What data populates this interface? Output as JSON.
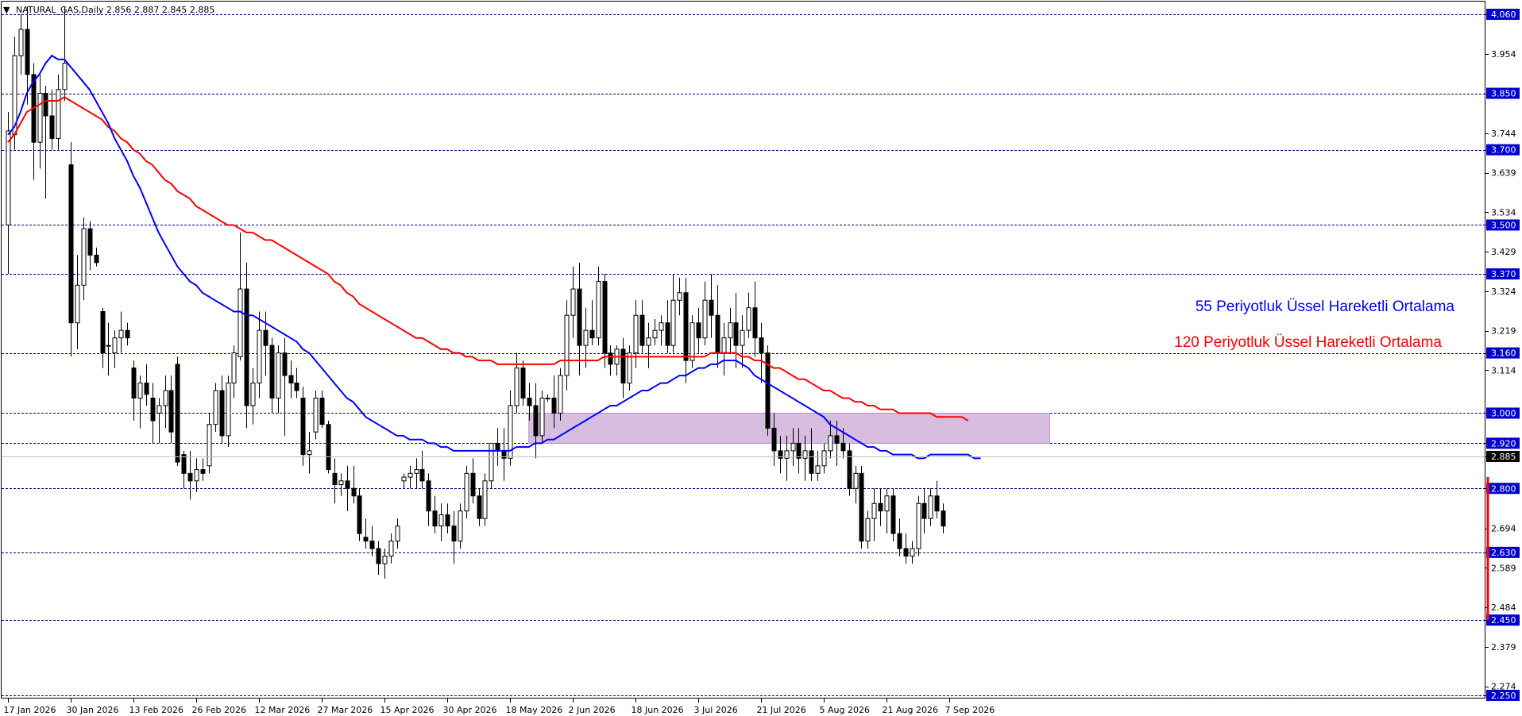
{
  "header": {
    "marker": "▼",
    "text": "NATURAL_GAS,Daily  2.856 2.887 2.845 2.885"
  },
  "legend": {
    "ema55": "55 Periyotluk Üssel Hareketli Ortalama",
    "ema120": "120 Periyotluk Üssel Hareketli Ortalama"
  },
  "colors": {
    "ema55": "#0000ff",
    "ema120": "#ff0000",
    "level_line": "#000080",
    "level_label_bg": "#0000cc",
    "zone": "#d7bde0",
    "bull_body": "#ffffff",
    "bear_body": "#000000",
    "current_price_bg": "#000000",
    "range_bar": "#ff0000"
  },
  "chart_data": {
    "type": "candlestick",
    "symbol": "NATURAL_GAS",
    "timeframe": "Daily",
    "last_ohlc": {
      "open": 2.856,
      "high": 2.887,
      "low": 2.845,
      "close": 2.885
    },
    "ylim": [
      2.25,
      4.07
    ],
    "y_ticks": [
      "4.060",
      "3.954",
      "3.850",
      "3.744",
      "3.700",
      "3.639",
      "3.534",
      "3.500",
      "3.429",
      "3.370",
      "3.324",
      "3.219",
      "3.160",
      "3.114",
      "3.000",
      "2.920",
      "2.885",
      "2.800",
      "2.694",
      "2.630",
      "2.589",
      "2.484",
      "2.450",
      "2.379",
      "2.274",
      "2.250"
    ],
    "x_ticks": [
      "17 Jan 2026",
      "30 Jan 2026",
      "13 Feb 2026",
      "26 Feb 2026",
      "12 Mar 2026",
      "27 Mar 2026",
      "15 Apr 2026",
      "30 Apr 2026",
      "18 May 2026",
      "2 Jun 2026",
      "18 Jun 2026",
      "3 Jul 2026",
      "21 Jul 2026",
      "5 Aug 2026",
      "21 Aug 2026",
      "7 Sep 2026"
    ],
    "x_tick_index": [
      0,
      10,
      20,
      30,
      40,
      50,
      60,
      70,
      80,
      90,
      100,
      110,
      120,
      130,
      140,
      150
    ],
    "levels": [
      4.06,
      3.85,
      3.7,
      3.5,
      3.37,
      3.16,
      3.0,
      2.92,
      2.8,
      2.63,
      2.45,
      2.25
    ],
    "current_price": 2.885,
    "zone": {
      "from_index": 83,
      "to_index": 166,
      "low": 2.92,
      "high": 3.0
    },
    "range_bar": {
      "low": 2.45,
      "high": 2.83
    },
    "candles": [
      [
        3.5,
        3.8,
        3.37,
        3.75
      ],
      [
        3.74,
        4.0,
        3.7,
        3.95
      ],
      [
        3.95,
        4.06,
        3.9,
        4.02
      ],
      [
        4.02,
        4.08,
        3.82,
        3.9
      ],
      [
        3.9,
        3.93,
        3.62,
        3.72
      ],
      [
        3.72,
        3.9,
        3.65,
        3.85
      ],
      [
        3.85,
        3.87,
        3.57,
        3.79
      ],
      [
        3.79,
        3.86,
        3.7,
        3.73
      ],
      [
        3.73,
        3.9,
        3.7,
        3.86
      ],
      [
        3.86,
        4.08,
        3.83,
        3.93
      ],
      [
        3.66,
        3.72,
        3.15,
        3.24
      ],
      [
        3.24,
        3.42,
        3.17,
        3.34
      ],
      [
        3.34,
        3.52,
        3.3,
        3.49
      ],
      [
        3.49,
        3.51,
        3.38,
        3.42
      ],
      [
        3.42,
        3.44,
        3.39,
        3.4
      ],
      [
        3.27,
        3.28,
        3.12,
        3.16
      ],
      [
        3.18,
        3.24,
        3.1,
        3.18
      ],
      [
        3.16,
        3.22,
        3.12,
        3.2
      ],
      [
        3.2,
        3.27,
        3.16,
        3.22
      ],
      [
        3.22,
        3.24,
        3.18,
        3.2
      ],
      [
        3.12,
        3.14,
        2.98,
        3.04
      ],
      [
        3.04,
        3.1,
        2.96,
        3.08
      ],
      [
        3.08,
        3.13,
        3.02,
        3.05
      ],
      [
        3.04,
        3.08,
        2.92,
        2.98
      ],
      [
        3.0,
        3.04,
        2.92,
        3.02
      ],
      [
        3.02,
        3.1,
        2.96,
        3.06
      ],
      [
        3.06,
        3.1,
        2.92,
        2.95
      ],
      [
        3.13,
        3.15,
        2.86,
        2.87
      ],
      [
        2.89,
        2.9,
        2.8,
        2.84
      ],
      [
        2.84,
        2.9,
        2.77,
        2.82
      ],
      [
        2.82,
        2.88,
        2.79,
        2.85
      ],
      [
        2.85,
        2.88,
        2.82,
        2.84
      ],
      [
        2.86,
        3.0,
        2.84,
        2.97
      ],
      [
        2.97,
        3.08,
        2.95,
        3.06
      ],
      [
        3.06,
        3.1,
        2.92,
        2.94
      ],
      [
        2.94,
        3.1,
        2.91,
        3.08
      ],
      [
        3.08,
        3.18,
        3.04,
        3.16
      ],
      [
        3.15,
        3.48,
        3.14,
        3.33
      ],
      [
        3.33,
        3.4,
        2.96,
        3.02
      ],
      [
        3.02,
        3.12,
        2.97,
        3.08
      ],
      [
        3.08,
        3.27,
        3.04,
        3.22
      ],
      [
        3.22,
        3.27,
        3.1,
        3.18
      ],
      [
        3.18,
        3.2,
        3.0,
        3.04
      ],
      [
        3.04,
        3.18,
        3.0,
        3.16
      ],
      [
        3.16,
        3.2,
        2.94,
        3.1
      ],
      [
        3.1,
        3.14,
        3.04,
        3.08
      ],
      [
        3.08,
        3.12,
        3.04,
        3.06
      ],
      [
        3.04,
        3.07,
        2.86,
        2.89
      ],
      [
        2.89,
        2.95,
        2.84,
        2.9
      ],
      [
        2.95,
        3.06,
        2.93,
        3.04
      ],
      [
        3.04,
        3.06,
        2.96,
        2.97
      ],
      [
        2.97,
        2.98,
        2.84,
        2.85
      ],
      [
        2.84,
        2.88,
        2.76,
        2.81
      ],
      [
        2.81,
        2.84,
        2.78,
        2.82
      ],
      [
        2.82,
        2.86,
        2.74,
        2.8
      ],
      [
        2.8,
        2.86,
        2.76,
        2.78
      ],
      [
        2.78,
        2.8,
        2.66,
        2.68
      ],
      [
        2.67,
        2.72,
        2.64,
        2.66
      ],
      [
        2.66,
        2.7,
        2.62,
        2.64
      ],
      [
        2.64,
        2.66,
        2.57,
        2.6
      ],
      [
        2.6,
        2.64,
        2.56,
        2.62
      ],
      [
        2.62,
        2.68,
        2.6,
        2.66
      ],
      [
        2.66,
        2.72,
        2.64,
        2.7
      ],
      [
        2.82,
        2.84,
        2.8,
        2.83
      ],
      [
        2.83,
        2.86,
        2.8,
        2.84
      ],
      [
        2.84,
        2.88,
        2.8,
        2.85
      ],
      [
        2.85,
        2.9,
        2.8,
        2.82
      ],
      [
        2.82,
        2.84,
        2.7,
        2.74
      ],
      [
        2.74,
        2.78,
        2.68,
        2.7
      ],
      [
        2.7,
        2.76,
        2.66,
        2.73
      ],
      [
        2.73,
        2.76,
        2.68,
        2.7
      ],
      [
        2.7,
        2.74,
        2.6,
        2.66
      ],
      [
        2.66,
        2.76,
        2.64,
        2.74
      ],
      [
        2.74,
        2.86,
        2.72,
        2.84
      ],
      [
        2.84,
        2.88,
        2.76,
        2.78
      ],
      [
        2.78,
        2.8,
        2.7,
        2.72
      ],
      [
        2.72,
        2.84,
        2.7,
        2.82
      ],
      [
        2.82,
        2.92,
        2.8,
        2.92
      ],
      [
        2.92,
        2.96,
        2.86,
        2.9
      ],
      [
        2.9,
        2.96,
        2.82,
        2.88
      ],
      [
        2.88,
        3.06,
        2.86,
        3.02
      ],
      [
        3.02,
        3.16,
        3.0,
        3.12
      ],
      [
        3.12,
        3.14,
        3.02,
        3.04
      ],
      [
        3.04,
        3.08,
        2.98,
        3.02
      ],
      [
        3.02,
        3.08,
        2.88,
        2.94
      ],
      [
        2.94,
        3.06,
        2.92,
        3.04
      ],
      [
        3.04,
        3.05,
        3.03,
        3.04
      ],
      [
        3.04,
        3.1,
        2.96,
        3.0
      ],
      [
        3.0,
        3.12,
        2.98,
        3.1
      ],
      [
        3.1,
        3.3,
        3.06,
        3.26
      ],
      [
        3.26,
        3.39,
        3.2,
        3.33
      ],
      [
        3.33,
        3.4,
        3.1,
        3.18
      ],
      [
        3.18,
        3.28,
        3.12,
        3.22
      ],
      [
        3.22,
        3.3,
        3.18,
        3.2
      ],
      [
        3.2,
        3.39,
        3.18,
        3.35
      ],
      [
        3.35,
        3.37,
        3.12,
        3.16
      ],
      [
        3.16,
        3.18,
        3.1,
        3.13
      ],
      [
        3.13,
        3.18,
        3.1,
        3.17
      ],
      [
        3.17,
        3.2,
        3.04,
        3.08
      ],
      [
        3.08,
        3.18,
        3.06,
        3.16
      ],
      [
        3.16,
        3.3,
        3.12,
        3.26
      ],
      [
        3.26,
        3.3,
        3.16,
        3.18
      ],
      [
        3.18,
        3.24,
        3.12,
        3.2
      ],
      [
        3.2,
        3.25,
        3.18,
        3.22
      ],
      [
        3.22,
        3.26,
        3.18,
        3.24
      ],
      [
        3.24,
        3.3,
        3.16,
        3.18
      ],
      [
        3.18,
        3.37,
        3.16,
        3.3
      ],
      [
        3.3,
        3.36,
        3.26,
        3.32
      ],
      [
        3.32,
        3.36,
        3.08,
        3.14
      ],
      [
        3.14,
        3.26,
        3.12,
        3.24
      ],
      [
        3.24,
        3.28,
        3.16,
        3.2
      ],
      [
        3.2,
        3.35,
        3.18,
        3.3
      ],
      [
        3.3,
        3.37,
        3.2,
        3.26
      ],
      [
        3.26,
        3.34,
        3.12,
        3.16
      ],
      [
        3.16,
        3.24,
        3.1,
        3.2
      ],
      [
        3.2,
        3.28,
        3.16,
        3.24
      ],
      [
        3.24,
        3.32,
        3.12,
        3.18
      ],
      [
        3.18,
        3.26,
        3.12,
        3.22
      ],
      [
        3.22,
        3.32,
        3.2,
        3.28
      ],
      [
        3.28,
        3.35,
        3.15,
        3.2
      ],
      [
        3.2,
        3.24,
        3.08,
        3.16
      ],
      [
        3.16,
        3.18,
        2.94,
        2.96
      ],
      [
        2.96,
        3.0,
        2.86,
        2.9
      ],
      [
        2.9,
        2.94,
        2.84,
        2.88
      ],
      [
        2.88,
        2.94,
        2.82,
        2.9
      ],
      [
        2.9,
        2.96,
        2.86,
        2.92
      ],
      [
        2.92,
        2.96,
        2.84,
        2.88
      ],
      [
        2.88,
        2.94,
        2.82,
        2.9
      ],
      [
        2.9,
        2.96,
        2.82,
        2.84
      ],
      [
        2.84,
        2.9,
        2.82,
        2.86
      ],
      [
        2.86,
        2.92,
        2.84,
        2.9
      ],
      [
        2.9,
        2.98,
        2.88,
        2.94
      ],
      [
        2.94,
        2.98,
        2.86,
        2.92
      ],
      [
        2.92,
        2.96,
        2.88,
        2.9
      ],
      [
        2.9,
        2.92,
        2.78,
        2.8
      ],
      [
        2.8,
        2.86,
        2.76,
        2.84
      ],
      [
        2.84,
        2.86,
        2.64,
        2.66
      ],
      [
        2.66,
        2.74,
        2.64,
        2.72
      ],
      [
        2.72,
        2.8,
        2.66,
        2.76
      ],
      [
        2.76,
        2.8,
        2.7,
        2.74
      ],
      [
        2.74,
        2.8,
        2.68,
        2.78
      ],
      [
        2.78,
        2.8,
        2.66,
        2.68
      ],
      [
        2.68,
        2.72,
        2.62,
        2.64
      ],
      [
        2.64,
        2.68,
        2.6,
        2.62
      ],
      [
        2.62,
        2.66,
        2.6,
        2.64
      ],
      [
        2.64,
        2.78,
        2.62,
        2.76
      ],
      [
        2.76,
        2.8,
        2.68,
        2.72
      ],
      [
        2.72,
        2.8,
        2.7,
        2.78
      ],
      [
        2.78,
        2.82,
        2.72,
        2.74
      ],
      [
        2.74,
        2.76,
        2.68,
        2.7
      ]
    ],
    "ema55": [
      3.74,
      3.76,
      3.8,
      3.85,
      3.88,
      3.9,
      3.93,
      3.95,
      3.94,
      3.94,
      3.92,
      3.9,
      3.88,
      3.86,
      3.83,
      3.8,
      3.77,
      3.73,
      3.7,
      3.67,
      3.63,
      3.6,
      3.56,
      3.52,
      3.48,
      3.45,
      3.42,
      3.39,
      3.37,
      3.35,
      3.34,
      3.32,
      3.31,
      3.3,
      3.29,
      3.28,
      3.27,
      3.27,
      3.26,
      3.26,
      3.25,
      3.24,
      3.23,
      3.22,
      3.21,
      3.2,
      3.19,
      3.17,
      3.16,
      3.14,
      3.12,
      3.1,
      3.08,
      3.06,
      3.04,
      3.03,
      3.01,
      2.99,
      2.98,
      2.97,
      2.96,
      2.95,
      2.94,
      2.94,
      2.93,
      2.93,
      2.93,
      2.92,
      2.92,
      2.91,
      2.91,
      2.9,
      2.9,
      2.9,
      2.9,
      2.9,
      2.9,
      2.9,
      2.9,
      2.9,
      2.9,
      2.91,
      2.91,
      2.91,
      2.92,
      2.92,
      2.93,
      2.93,
      2.94,
      2.95,
      2.96,
      2.97,
      2.98,
      2.99,
      3.0,
      3.01,
      3.02,
      3.02,
      3.03,
      3.04,
      3.05,
      3.06,
      3.06,
      3.07,
      3.08,
      3.08,
      3.09,
      3.1,
      3.1,
      3.11,
      3.12,
      3.12,
      3.13,
      3.13,
      3.14,
      3.14,
      3.14,
      3.13,
      3.12,
      3.1,
      3.09,
      3.08,
      3.07,
      3.06,
      3.05,
      3.04,
      3.03,
      3.02,
      3.01,
      3.0,
      2.99,
      2.97,
      2.96,
      2.95,
      2.94,
      2.93,
      2.92,
      2.91,
      2.91,
      2.9,
      2.9,
      2.89,
      2.89,
      2.89,
      2.89,
      2.88,
      2.88,
      2.89,
      2.89,
      2.89,
      2.89,
      2.89,
      2.89,
      2.89,
      2.88,
      2.88
    ],
    "ema120": [
      3.72,
      3.74,
      3.77,
      3.8,
      3.81,
      3.82,
      3.83,
      3.83,
      3.83,
      3.84,
      3.83,
      3.82,
      3.81,
      3.8,
      3.79,
      3.78,
      3.76,
      3.75,
      3.73,
      3.72,
      3.7,
      3.69,
      3.67,
      3.66,
      3.64,
      3.62,
      3.61,
      3.59,
      3.58,
      3.57,
      3.55,
      3.54,
      3.53,
      3.52,
      3.51,
      3.5,
      3.5,
      3.49,
      3.48,
      3.48,
      3.47,
      3.46,
      3.46,
      3.45,
      3.44,
      3.43,
      3.42,
      3.41,
      3.4,
      3.39,
      3.38,
      3.37,
      3.35,
      3.34,
      3.32,
      3.31,
      3.29,
      3.28,
      3.27,
      3.26,
      3.25,
      3.24,
      3.23,
      3.22,
      3.21,
      3.2,
      3.2,
      3.19,
      3.18,
      3.17,
      3.17,
      3.16,
      3.16,
      3.15,
      3.15,
      3.14,
      3.14,
      3.14,
      3.13,
      3.13,
      3.13,
      3.13,
      3.13,
      3.13,
      3.13,
      3.13,
      3.13,
      3.13,
      3.14,
      3.14,
      3.14,
      3.14,
      3.14,
      3.14,
      3.14,
      3.15,
      3.15,
      3.15,
      3.15,
      3.15,
      3.15,
      3.15,
      3.15,
      3.15,
      3.15,
      3.15,
      3.15,
      3.15,
      3.15,
      3.15,
      3.15,
      3.15,
      3.16,
      3.16,
      3.16,
      3.16,
      3.16,
      3.15,
      3.15,
      3.14,
      3.14,
      3.13,
      3.12,
      3.12,
      3.11,
      3.1,
      3.09,
      3.09,
      3.08,
      3.07,
      3.06,
      3.06,
      3.05,
      3.04,
      3.04,
      3.03,
      3.03,
      3.02,
      3.02,
      3.01,
      3.01,
      3.01,
      3.0,
      3.0,
      3.0,
      3.0,
      3.0,
      3.0,
      2.99,
      2.99,
      2.99,
      2.99,
      2.99,
      2.98
    ]
  }
}
